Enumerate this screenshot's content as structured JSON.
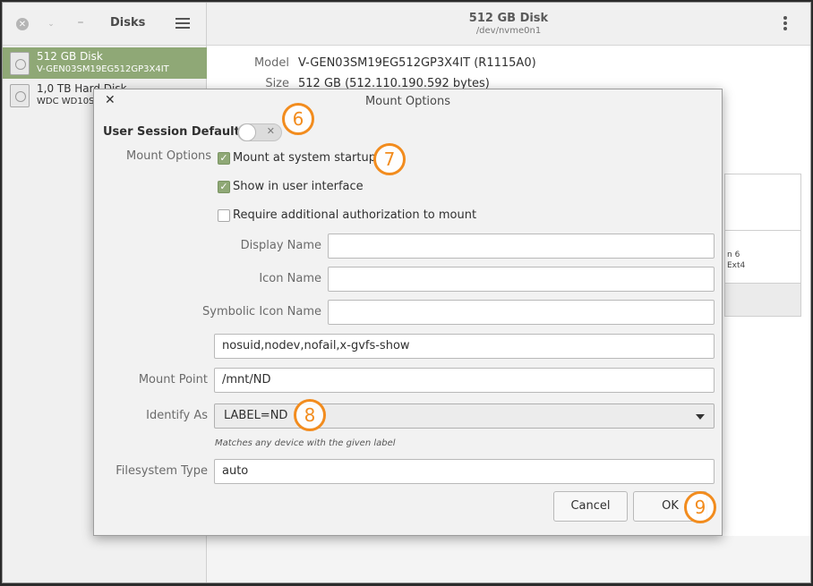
{
  "sidebar": {
    "title": "Disks",
    "drives": [
      {
        "name": "512 GB Disk",
        "sub": "V-GEN03SM19EG512GP3X4IT"
      },
      {
        "name": "1,0 TB Hard Disk",
        "sub": "WDC WD10S"
      }
    ]
  },
  "header": {
    "title": "512 GB Disk",
    "subtitle": "/dev/nvme0n1"
  },
  "info": {
    "model_label": "Model",
    "model_value": "V-GEN03SM19EG512GP3X4IT (R1115A0)",
    "size_label": "Size",
    "size_value": "512 GB (512.110.190.592 bytes)"
  },
  "volumes": {
    "line1": "n 6",
    "line2": "Ext4"
  },
  "dialog": {
    "title": "Mount Options",
    "user_session_defaults": "User Session Defaults",
    "user_session_defaults_on": false,
    "mount_options_label": "Mount Options",
    "checkboxes": [
      {
        "label": "Mount at system startup",
        "checked": true
      },
      {
        "label": "Show in user interface",
        "checked": true
      },
      {
        "label": "Require additional authorization to mount",
        "checked": false
      }
    ],
    "display_name_label": "Display Name",
    "display_name_value": "",
    "icon_name_label": "Icon Name",
    "icon_name_value": "",
    "symbolic_icon_name_label": "Symbolic Icon Name",
    "symbolic_icon_name_value": "",
    "options_value": "nosuid,nodev,nofail,x-gvfs-show",
    "mount_point_label": "Mount Point",
    "mount_point_value": "/mnt/ND",
    "identify_as_label": "Identify As",
    "identify_as_value": "LABEL=ND",
    "identify_hint": "Matches any device with the given label",
    "fs_type_label": "Filesystem Type",
    "fs_type_value": "auto",
    "cancel_label": "Cancel",
    "ok_label": "OK"
  },
  "markers": [
    "6",
    "7",
    "8",
    "9"
  ],
  "colors": {
    "accent": "#8fa876",
    "marker": "#f28c1e"
  }
}
